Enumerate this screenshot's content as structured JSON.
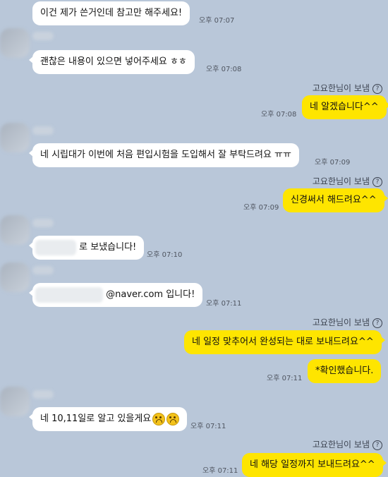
{
  "messages": [
    {
      "text": "이건 제가 쓴거인데 참고만 해주세요!",
      "time": "오후 07:07"
    },
    {
      "text": "괜찮은 내용이 있으면 넣어주세요 ㅎㅎ",
      "time": "오후 07:08"
    },
    {
      "sender": "고요한님이 보냄",
      "text": "네 알겠습니다^^",
      "time": "오후 07:08"
    },
    {
      "text": "네 시립대가 이번에 처음 편입시험을 도입해서 잘 부탁드려요 ㅠㅠ",
      "time": "오후 07:09"
    },
    {
      "sender": "고요한님이 보냄",
      "text": "신경써서 해드려요^^",
      "time": "오후 07:09"
    },
    {
      "text": "로 보냈습니다!",
      "time": "오후 07:10"
    },
    {
      "text": "@naver.com 입니다!",
      "time": "오후 07:11"
    },
    {
      "sender": "고요한님이 보냄",
      "text": "네 일정 맞추어서 완성되는 대로 보내드려요^^",
      "time": ""
    },
    {
      "text": "*확인했습니다.",
      "time": "오후 07:11"
    },
    {
      "text": "네 10,11일로 알고 있을게요",
      "time": "오후 07:11"
    },
    {
      "sender": "고요한님이 보냄",
      "text": "네 해당 일정까지 보내드려요^^",
      "time": "오후 07:11"
    }
  ],
  "help_glyph": "?",
  "colors": {
    "background": "#b9c7d9",
    "outgoing": "#fee500",
    "incoming": "#ffffff"
  }
}
